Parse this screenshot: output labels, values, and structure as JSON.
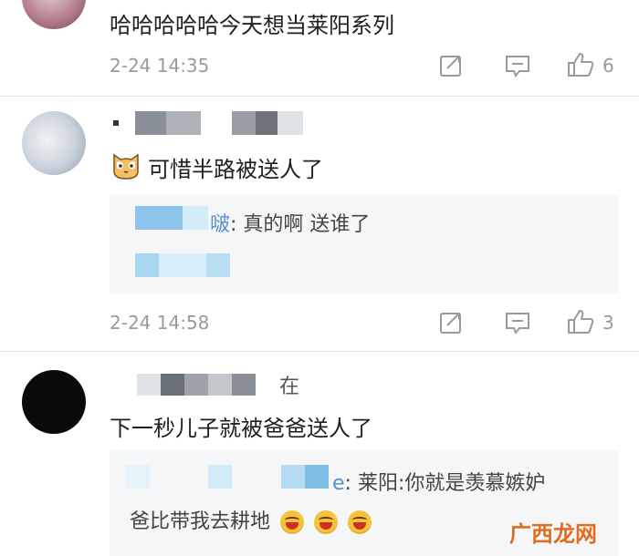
{
  "comments": [
    {
      "text": "哈哈哈哈哈今天想当莱阳系列",
      "date": "2-24 14:35",
      "likes": "6"
    },
    {
      "text": "可惜半路被送人了",
      "reply": {
        "name_tail": "​啵",
        "text": ": 真的啊 送谁了"
      },
      "date": "2-24 14:58",
      "likes": "3"
    },
    {
      "username_tail": "在",
      "text": "下一秒儿子就被爸爸送人了",
      "reply": {
        "name_tail": "e",
        "line1": ": 莱阳:你就是羡慕嫉妒",
        "line2": "爸比带我去耕地"
      }
    }
  ],
  "watermark": "广西龙网",
  "icons": {
    "share": "share-icon",
    "comment": "comment-icon",
    "like": "thumbs-up-icon",
    "emoji_cat": "cat-emoji-icon",
    "emoji_laugh": "laugh-emoji-icon"
  }
}
